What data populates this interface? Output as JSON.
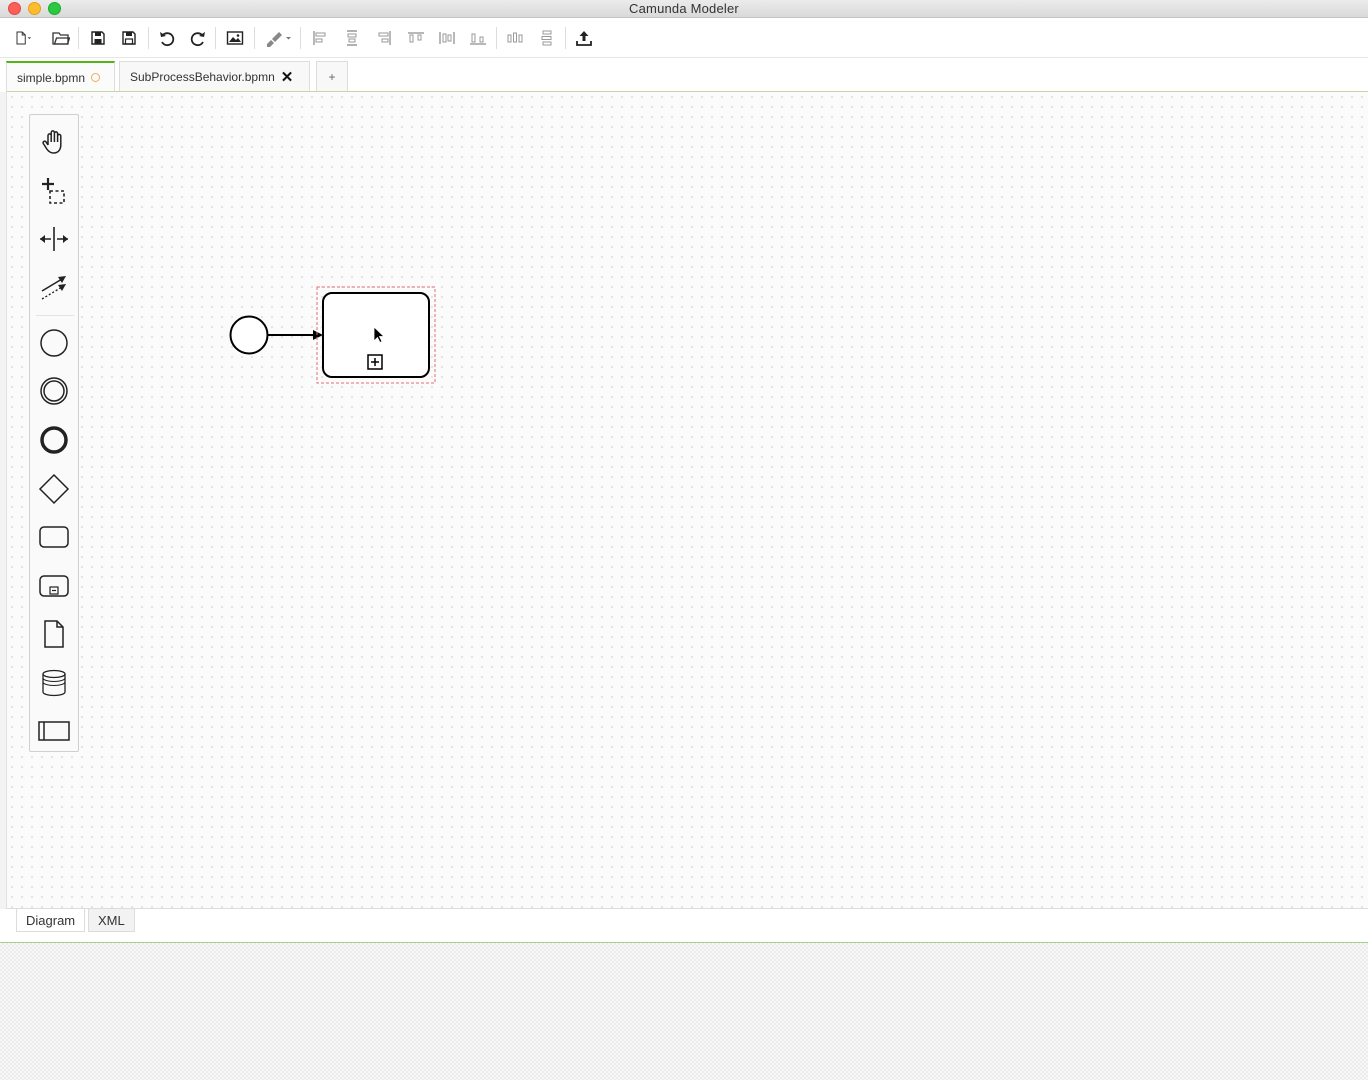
{
  "window": {
    "title": "Camunda Modeler"
  },
  "toolbar": {
    "buttons": [
      {
        "name": "new-file-icon"
      },
      {
        "name": "open-file-icon"
      },
      {
        "name": "save-icon"
      },
      {
        "name": "save-as-icon"
      },
      {
        "name": "undo-icon"
      },
      {
        "name": "redo-icon"
      },
      {
        "name": "export-image-icon"
      },
      {
        "name": "edit-colors-icon"
      },
      {
        "name": "align-left-icon"
      },
      {
        "name": "align-center-icon"
      },
      {
        "name": "align-right-icon"
      },
      {
        "name": "align-top-icon"
      },
      {
        "name": "align-middle-icon"
      },
      {
        "name": "align-bottom-icon"
      },
      {
        "name": "distribute-horizontal-icon"
      },
      {
        "name": "distribute-vertical-icon"
      },
      {
        "name": "deploy-icon"
      }
    ]
  },
  "tabs": [
    {
      "label": "simple.bpmn",
      "active": true,
      "dirty": true
    },
    {
      "label": "SubProcessBehavior.bpmn",
      "active": false,
      "close": "✕"
    }
  ],
  "add_tab_label": "+",
  "palette": [
    "hand-tool-icon",
    "lasso-tool-icon",
    "space-tool-icon",
    "global-connect-tool-icon",
    "start-event-icon",
    "intermediate-event-icon",
    "end-event-icon",
    "gateway-icon",
    "task-icon",
    "subprocess-icon",
    "data-object-icon",
    "data-store-icon",
    "pool-icon"
  ],
  "diagram": {
    "elements": [
      "start-event",
      "sequence-flow",
      "collapsed-subprocess"
    ],
    "selected": "collapsed-subprocess",
    "colors": {
      "stroke": "#000000",
      "selection": "#e36f6f"
    }
  },
  "bottom_tabs": [
    {
      "label": "Diagram",
      "active": true
    },
    {
      "label": "XML",
      "active": false
    }
  ]
}
